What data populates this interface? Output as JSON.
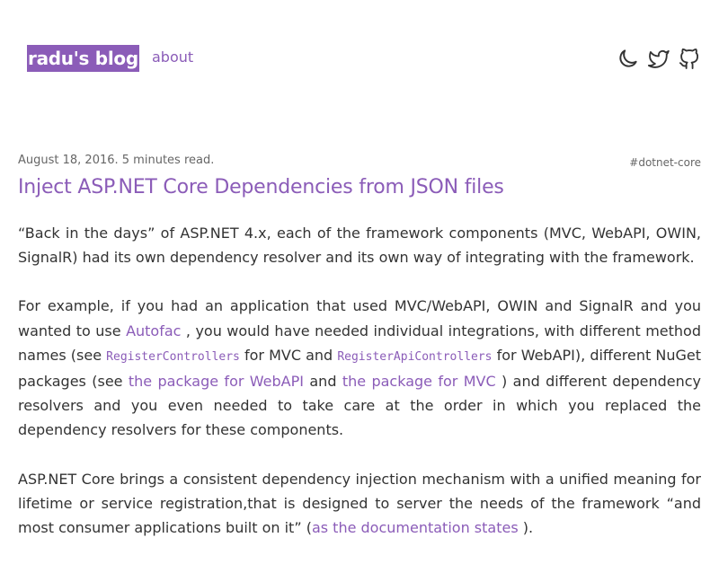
{
  "header": {
    "site_title": "radu's blog",
    "nav_about": "about",
    "icons": [
      "moon-icon",
      "twitter-icon",
      "github-icon"
    ]
  },
  "post": {
    "date": "August 18, 2016. 5 minutes read.",
    "tag": "#dotnet-core",
    "title": "Inject ASP.NET Core Dependencies from JSON files",
    "p1": "“Back in the days” of ASP.NET 4.x, each of the framework components (MVC, WebAPI, OWIN, SignalR) had its own dependency resolver and its own way of integrating with the framework.",
    "p2": {
      "t1": "For example, if you had an application that used MVC/WebAPI, OWIN and SignalR and you wanted to use ",
      "link_autofac": "Autofac",
      "t2": " , you would have needed individual integrations, with different method names (see ",
      "code1": "RegisterControllers",
      "t3": " for MVC and ",
      "code2": "RegisterApiControllers",
      "t4": " for WebAPI), different NuGet packages (see ",
      "link_webapi": "the package for WebAPI",
      "t5": " and ",
      "link_mvc": "the package for MVC",
      "t6": " ) and different dependency resolvers and you even needed to take care at the order in which you replaced the dependency resolvers for these components."
    },
    "p3": {
      "t1": "ASP.NET Core brings a consistent dependency injection mechanism with a unified meaning for lifetime or service registration,that is designed to server the needs of the framework “and most consumer applications built on it” (",
      "link_docs": "as the documentation states",
      "t2": " )."
    }
  },
  "colors": {
    "accent": "#8b5cb8",
    "text": "#333333",
    "muted": "#666666",
    "background": "#ffffff"
  }
}
